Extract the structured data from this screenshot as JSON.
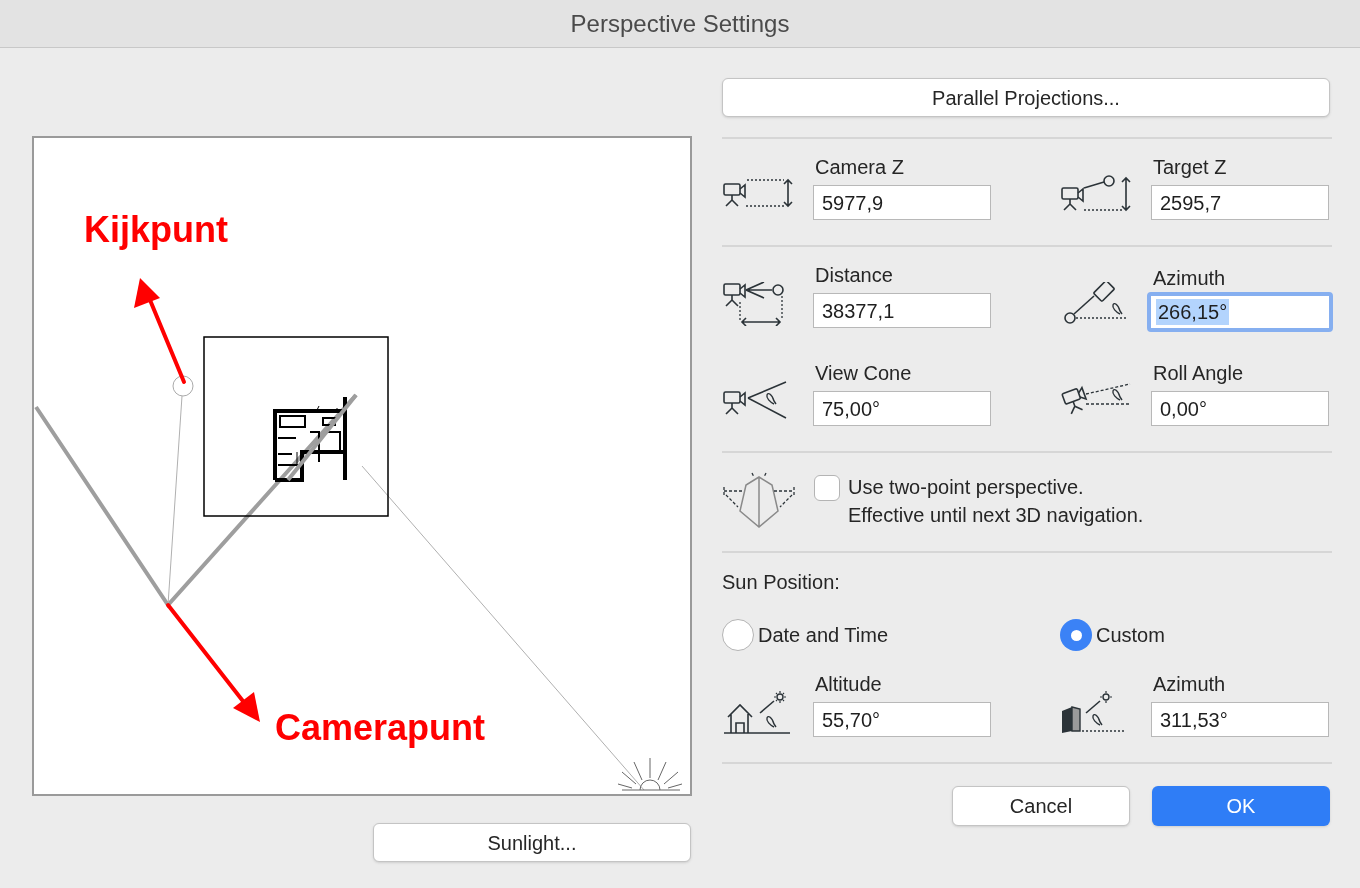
{
  "window": {
    "title": "Perspective Settings"
  },
  "preview": {
    "labels": [
      {
        "text": "Kijkpunt"
      },
      {
        "text": "Camerapunt"
      }
    ]
  },
  "parallel_button": "Parallel Projections...",
  "field_groups": [
    [
      {
        "label": "Camera Z",
        "value": "5977,9",
        "focused": false
      },
      {
        "label": "Target Z",
        "value": "2595,7",
        "focused": false
      }
    ],
    [
      {
        "label": "Distance",
        "value": "38377,1",
        "focused": false
      },
      {
        "label": "Azimuth",
        "value": "266,15°",
        "focused": true
      },
      {
        "label": "View Cone",
        "value": "75,00°",
        "focused": false
      },
      {
        "label": "Roll Angle",
        "value": "0,00°",
        "focused": false
      }
    ]
  ],
  "two_point": {
    "checked": false,
    "lines": [
      "Use two-point perspective.",
      "Effective until next 3D navigation."
    ]
  },
  "sun_position": {
    "title": "Sun Position:",
    "options": [
      {
        "label": "Date and Time",
        "selected": false
      },
      {
        "label": "Custom",
        "selected": true
      }
    ],
    "fields": [
      {
        "label": "Altitude",
        "value": "55,70°",
        "focused": false
      },
      {
        "label": "Azimuth",
        "value": "311,53°",
        "focused": false
      }
    ]
  },
  "sunlight_button": "Sunlight...",
  "buttons": [
    {
      "label": "Cancel",
      "default": false
    },
    {
      "label": "OK",
      "default": true
    }
  ]
}
